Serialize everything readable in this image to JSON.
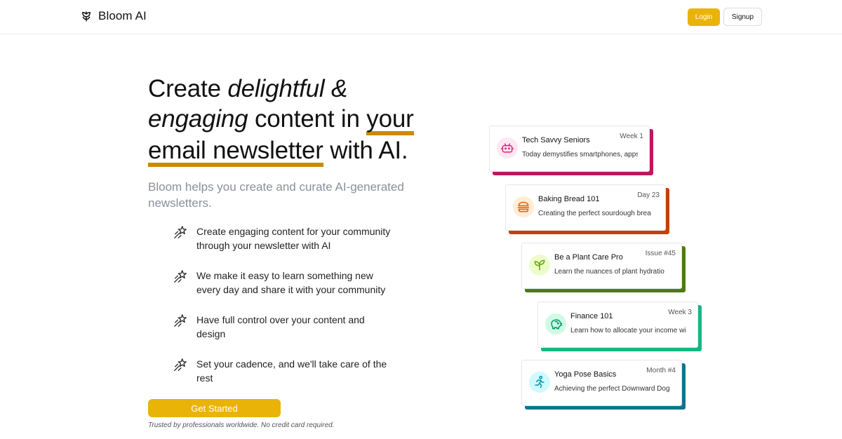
{
  "header": {
    "brand": "Bloom AI",
    "login_label": "Login",
    "signup_label": "Signup"
  },
  "hero": {
    "title_parts": {
      "p1": "Create ",
      "p2": "delightful &",
      "p3": "engaging",
      "p4": " content in ",
      "p5": "your",
      "p6": "email newsletter",
      "p7": " with AI."
    },
    "subtitle": "Bloom helps you create and curate AI-generated newsletters.",
    "features": [
      {
        "text": "Create engaging content for your community through your newsletter with AI",
        "icon": "sparkle-star-icon"
      },
      {
        "text": "We make it easy to learn something new every day and share it with your community",
        "icon": "sparkle-star-icon"
      },
      {
        "text": "Have full control over your content and design",
        "icon": "sparkle-star-icon"
      },
      {
        "text": "Set your cadence, and we'll take care of the rest",
        "icon": "sparkle-star-icon"
      }
    ],
    "cta_label": "Get Started",
    "trust_note": "Trusted by professionals worldwide. No credit card required."
  },
  "cards": [
    {
      "title": "Tech Savvy Seniors",
      "badge": "Week 1",
      "desc": "Today demystifies smartphones, apps",
      "icon": "robot-icon",
      "accent": "#be185d",
      "icon_bg": "#fce7f3",
      "icon_color": "#db2777"
    },
    {
      "title": "Baking Bread 101",
      "badge": "Day 23",
      "desc": "Creating the perfect sourdough brea",
      "icon": "burger-icon",
      "accent": "#c2410c",
      "icon_bg": "#ffedd5",
      "icon_color": "#ea580c"
    },
    {
      "title": "Be a Plant Care Pro",
      "badge": "Issue #45",
      "desc": "Learn the nuances of plant hydratio",
      "icon": "leaf-icon",
      "accent": "#4d7c0f",
      "icon_bg": "#ecfccb",
      "icon_color": "#65a30d"
    },
    {
      "title": "Finance 101",
      "badge": "Week 3",
      "desc": "Learn how to allocate your income wis",
      "icon": "piggy-bank-icon",
      "accent": "#10b981",
      "icon_bg": "#d1fae5",
      "icon_color": "#059669"
    },
    {
      "title": "Yoga Pose Basics",
      "badge": "Month #4",
      "desc": "Achieving the perfect Downward Dog,",
      "icon": "running-figure-icon",
      "accent": "#0e7490",
      "icon_bg": "#cffafe",
      "icon_color": "#0891b2"
    }
  ],
  "colors": {
    "primary": "#eab308",
    "underline": "#ca8a04"
  }
}
